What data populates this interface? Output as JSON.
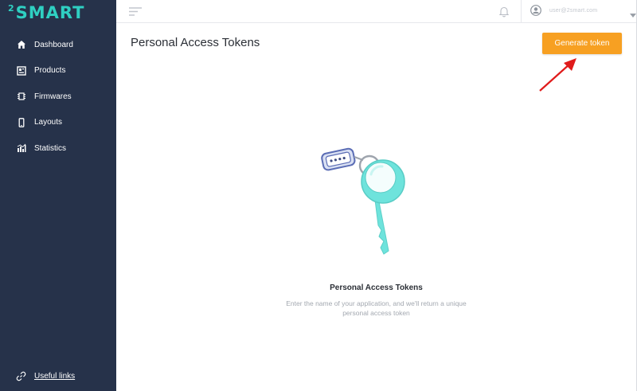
{
  "brand": {
    "logo_superscript": "2",
    "logo_text": "SMART"
  },
  "sidebar": {
    "items": [
      {
        "label": "Dashboard",
        "icon": "home-icon"
      },
      {
        "label": "Products",
        "icon": "products-icon"
      },
      {
        "label": "Firmwares",
        "icon": "chip-icon"
      },
      {
        "label": "Layouts",
        "icon": "phone-icon"
      },
      {
        "label": "Statistics",
        "icon": "bar-chart-icon"
      }
    ],
    "footer_link": {
      "label": "Useful links",
      "icon": "link-icon"
    }
  },
  "topbar": {
    "menu_icon": "menu-icon",
    "notification_icon": "bell-icon",
    "user_email": "user@2smart.com",
    "user_icon": "user-avatar-icon",
    "dropdown_icon": "caret-down-icon"
  },
  "main": {
    "title": "Personal Access Tokens",
    "generate_button": "Generate token",
    "empty_state": {
      "title": "Personal Access Tokens",
      "description": "Enter the name of your application, and we'll return a unique personal access token"
    }
  },
  "colors": {
    "sidebar_bg": "#26324a",
    "brand_accent": "#2fd0c2",
    "button_orange": "#f7a022",
    "annotation_arrow": "#e01b1b",
    "key_teal": "#6ee3dc"
  }
}
